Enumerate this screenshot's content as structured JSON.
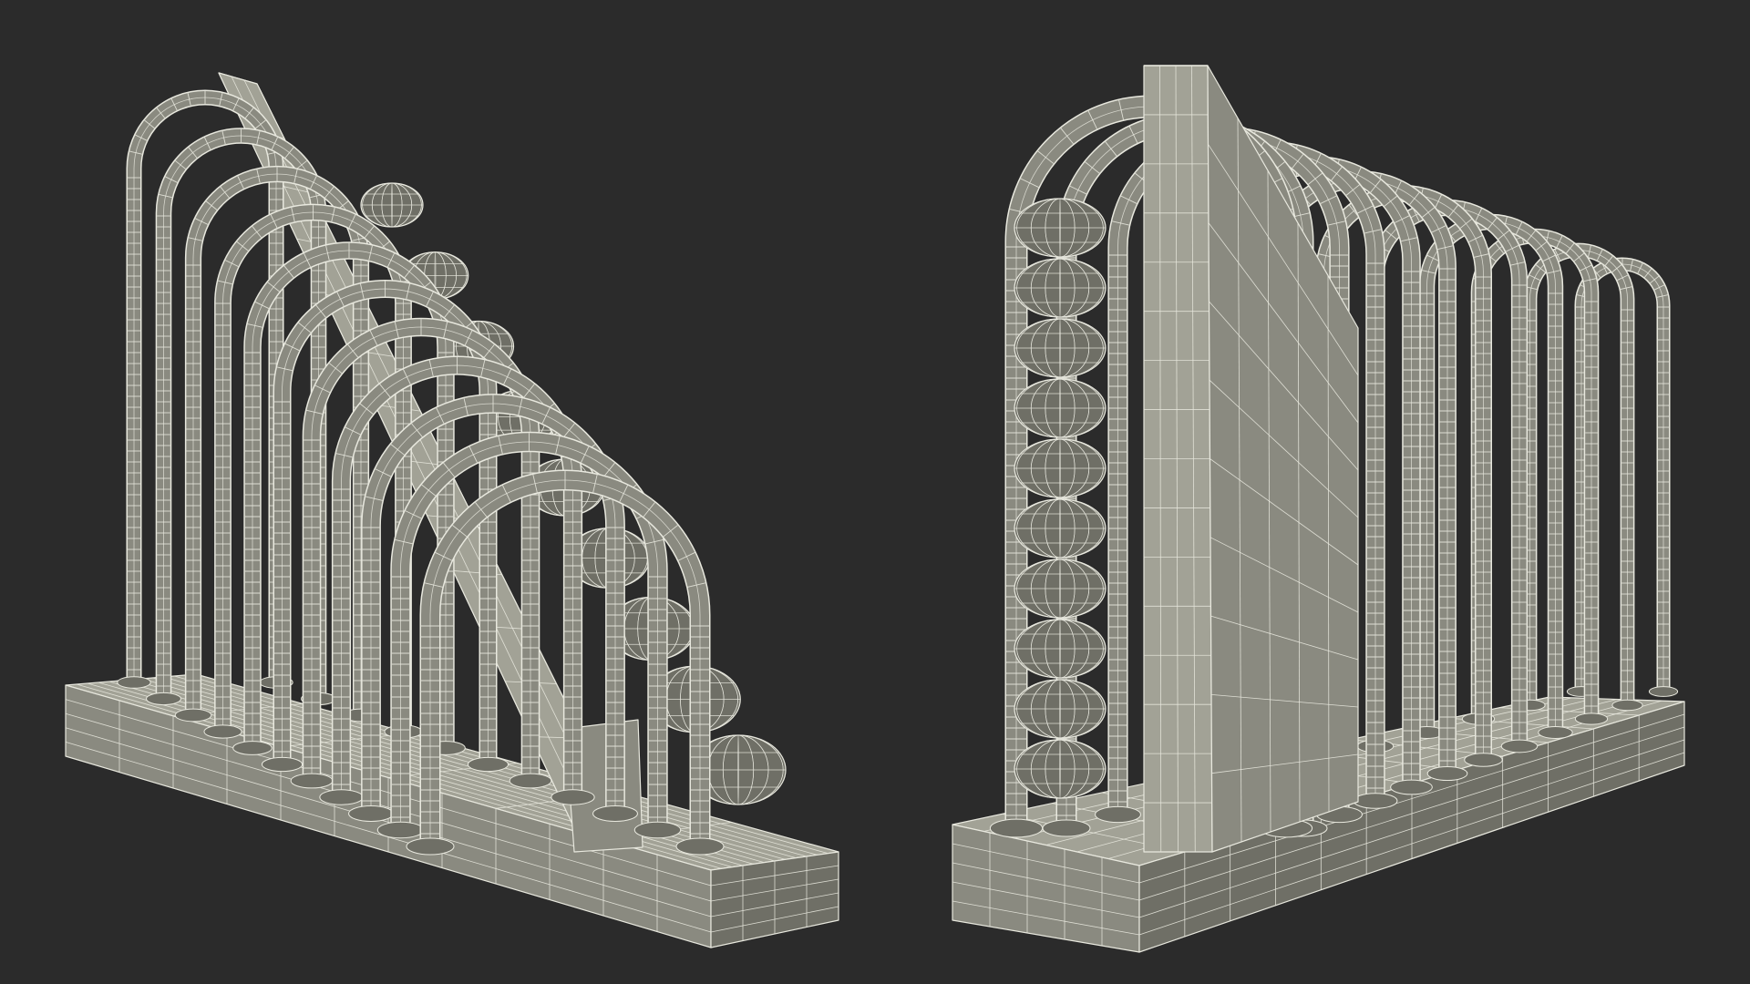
{
  "scene": {
    "background": "#2b2b2b",
    "mesh_fill": "#8a8a80",
    "mesh_fill_dark": "#6f6f66",
    "mesh_fill_light": "#a2a296",
    "wire_color": "#e8e8de",
    "views": [
      {
        "name": "left-view",
        "arches": 11,
        "beads": 9
      },
      {
        "name": "right-view",
        "arches": 11,
        "beads": 10
      }
    ]
  }
}
